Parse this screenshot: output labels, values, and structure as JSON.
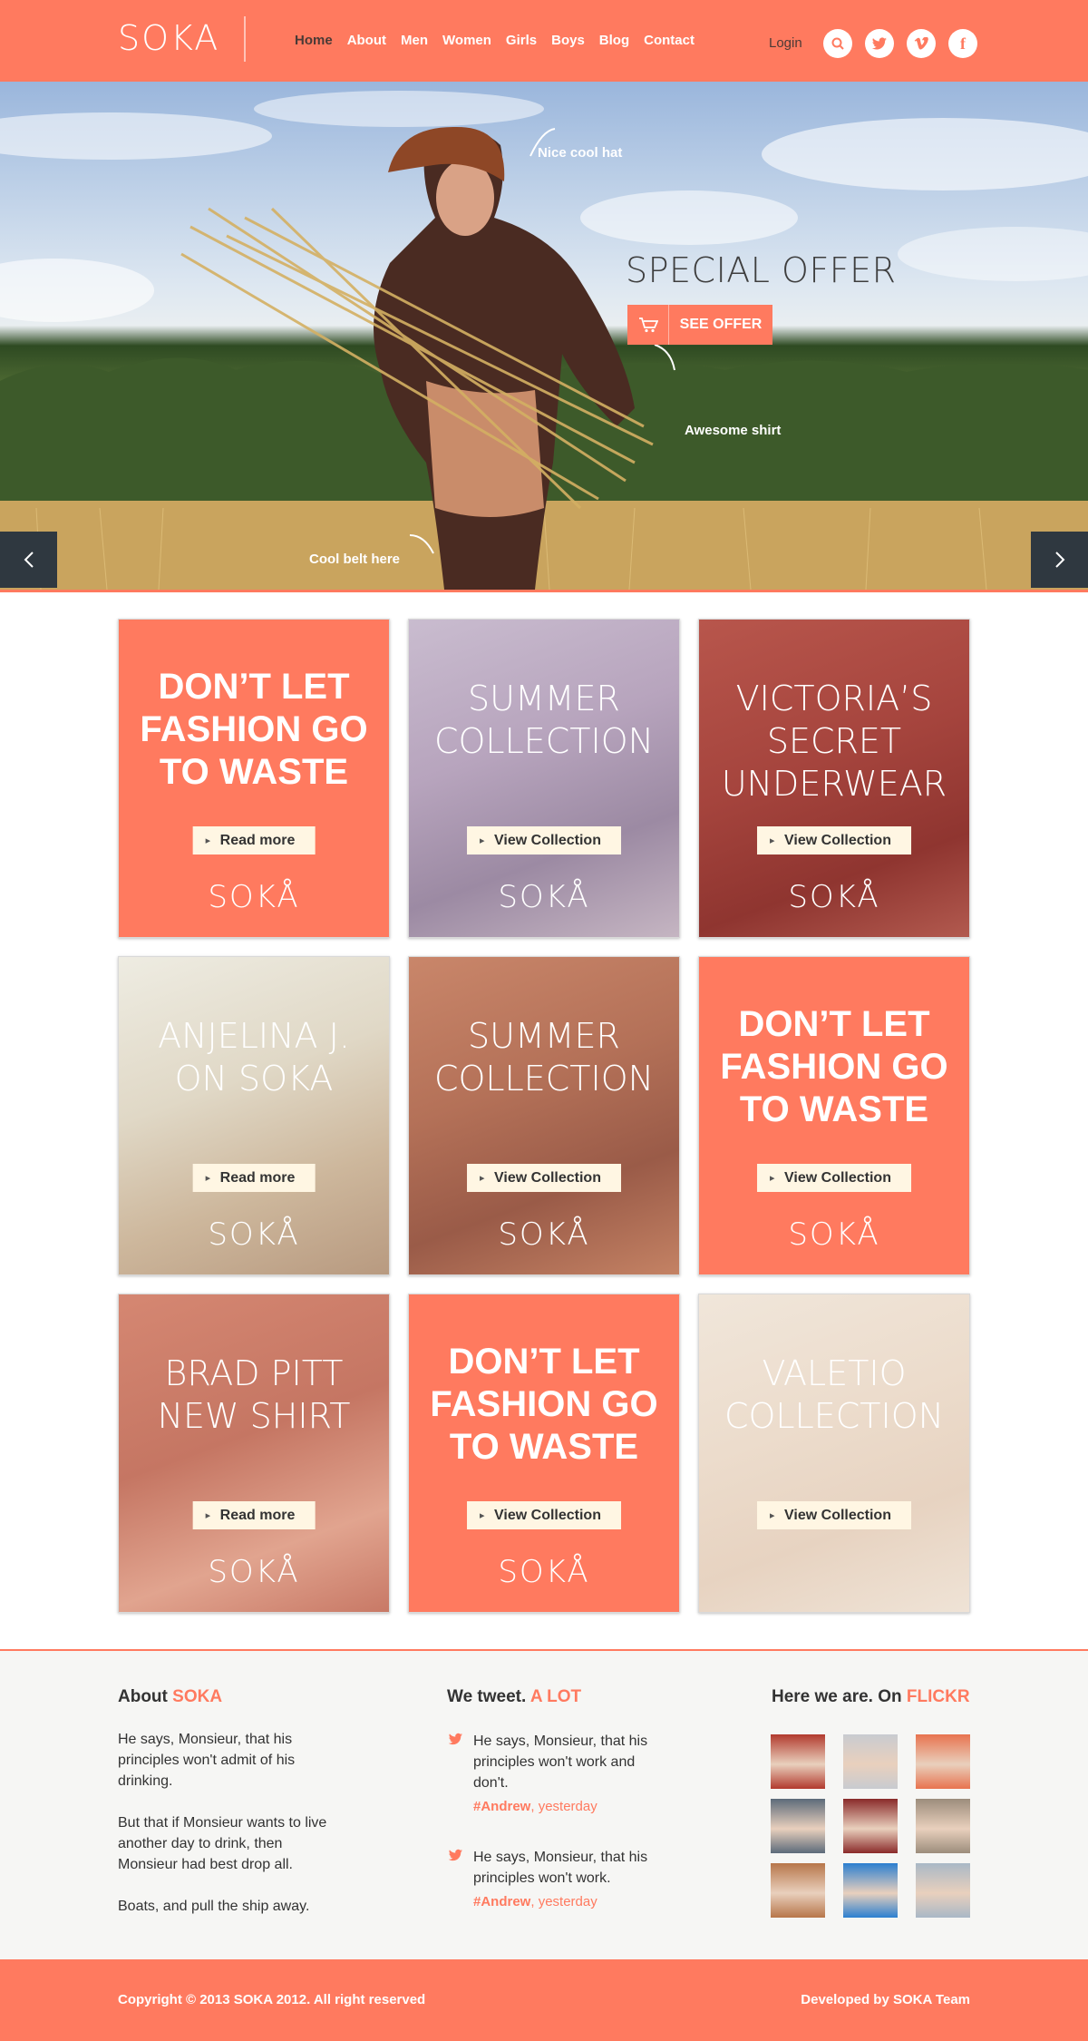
{
  "brand": {
    "logo": "SOKA"
  },
  "nav": {
    "items": [
      "Home",
      "About",
      "Men",
      "Women",
      "Girls",
      "Boys",
      "Blog",
      "Contact"
    ],
    "active": "Home",
    "login": "Login"
  },
  "social": [
    "search-icon",
    "twitter-icon",
    "vimeo-icon",
    "facebook-icon"
  ],
  "hero": {
    "annotations": {
      "hat": "Nice cool hat",
      "shirt": "Awesome shirt",
      "belt": "Cool belt here"
    },
    "offer_title": "SPECIAL OFFER",
    "offer_button": "SEE OFFER"
  },
  "cards": [
    {
      "title_lines": [
        "DON’T LET",
        "FASHION GO",
        "TO WASTE"
      ],
      "button": "Read more",
      "brand": "SOKÅ",
      "style": "coral"
    },
    {
      "title_lines": [
        "SUMMER",
        "COLLECTION"
      ],
      "button": "View Collection",
      "brand": "SOKÅ",
      "style": "photo-lavender"
    },
    {
      "title_lines": [
        "VICTORIA’S",
        "SECRET",
        "UNDERWEAR"
      ],
      "button": "View Collection",
      "brand": "SOKÅ",
      "style": "photo-red"
    },
    {
      "title_lines": [
        "ANJELINA J.",
        "ON SOKA"
      ],
      "button": "Read more",
      "brand": "SOKÅ",
      "style": "photo-pale"
    },
    {
      "title_lines": [
        "SUMMER",
        "COLLECTION"
      ],
      "button": "View Collection",
      "brand": "SOKÅ",
      "style": "photo-brown"
    },
    {
      "title_lines": [
        "DON’T LET",
        "FASHION GO",
        "TO WASTE"
      ],
      "button": "View Collection",
      "brand": "SOKÅ",
      "style": "coral"
    },
    {
      "title_lines": [
        "BRAD PITT",
        "NEW SHIRT"
      ],
      "button": "Read more",
      "brand": "SOKÅ",
      "style": "photo-salmon"
    },
    {
      "title_lines": [
        "DON’T LET",
        "FASHION GO",
        "TO WASTE"
      ],
      "button": "View Collection",
      "brand": "SOKÅ",
      "style": "coral"
    },
    {
      "title_lines": [
        "VALETIO",
        "COLLECTION"
      ],
      "button": "View Collection",
      "brand": "",
      "style": "photo-cream"
    }
  ],
  "footer": {
    "about": {
      "heading": "About",
      "heading_accent": "SOKA",
      "paragraphs": [
        "He says, Monsieur, that his principles won't admit of his drinking.",
        "But that if Monsieur wants to live another day to drink, then Monsieur had best drop all.",
        "Boats, and pull the ship away."
      ]
    },
    "tweets": {
      "heading": "We tweet.",
      "heading_accent": "A LOT",
      "items": [
        {
          "text": "He says, Monsieur, that his principles won't work and don't.",
          "author": "#Andrew",
          "time": ", yesterday"
        },
        {
          "text": "He says, Monsieur, that his principles won't work.",
          "author": "#Andrew",
          "time": ", yesterday"
        }
      ]
    },
    "flickr": {
      "heading": "Here we are. On",
      "heading_accent": "FLICKR",
      "thumb_colors": [
        "#b23a2e",
        "#c8cbd0",
        "#e8734f",
        "#5c6b7a",
        "#8a2a2a",
        "#9c8d7c",
        "#b7764a",
        "#2b7fd0",
        "#a9b8c6"
      ]
    }
  },
  "bottom": {
    "copyright": "Copyright © 2013 SOKA 2012. All right reserved",
    "developed": "Developed by SOKA Team"
  },
  "colors": {
    "accent": "#ff7a5f",
    "dark": "#2f3840",
    "button_bg": "#fff6e3"
  }
}
